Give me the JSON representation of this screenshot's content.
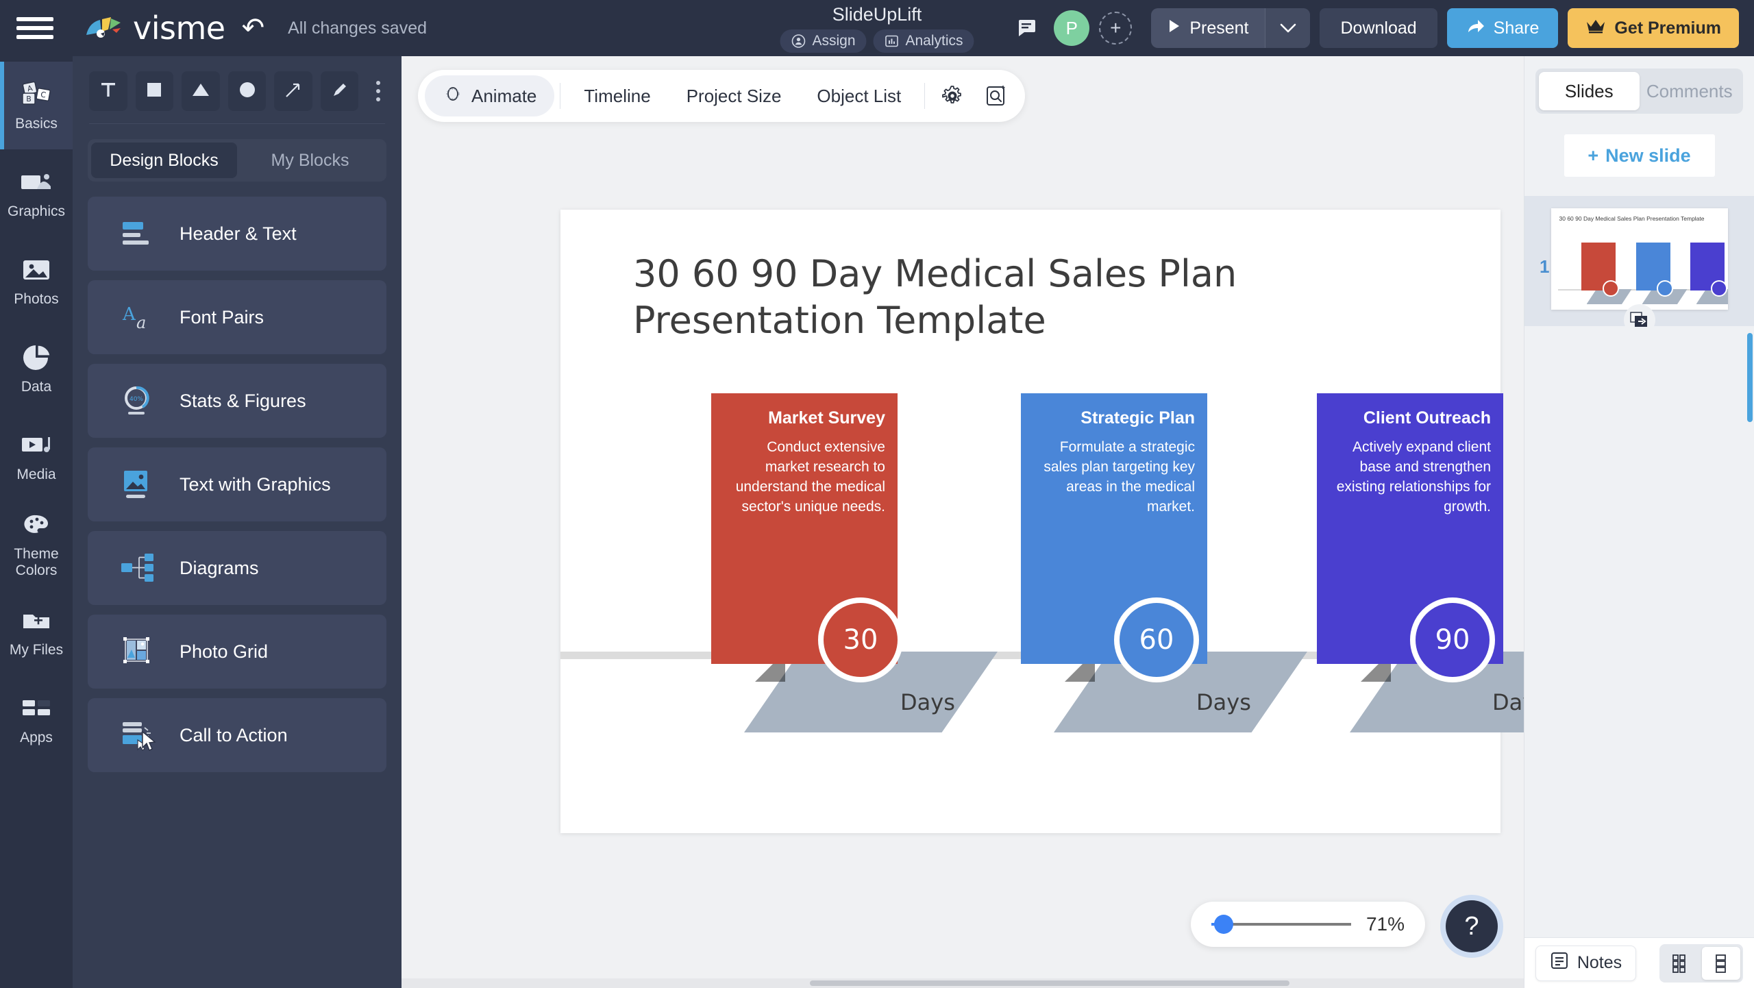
{
  "topbar": {
    "menu_icon": "hamburger-icon",
    "brand": "visme",
    "undo_icon": "undo-icon",
    "save_status": "All changes saved",
    "doc_title": "SlideUpLift",
    "assign_label": "Assign",
    "analytics_label": "Analytics",
    "comment_icon": "comment-icon",
    "avatar_initial": "P",
    "add_collaborator_icon": "add-user-icon",
    "present_label": "Present",
    "present_caret_icon": "chevron-down-icon",
    "download_label": "Download",
    "share_label": "Share",
    "premium_label": "Get Premium",
    "colors": {
      "share": "#4aa3dd",
      "premium": "#f5c25c",
      "bar": "#2b3245"
    }
  },
  "rail": {
    "items": [
      {
        "label": "Basics",
        "icon": "basics-cards-icon",
        "active": true
      },
      {
        "label": "Graphics",
        "icon": "graphics-icon",
        "active": false
      },
      {
        "label": "Photos",
        "icon": "photos-icon",
        "active": false
      },
      {
        "label": "Data",
        "icon": "data-piechart-icon",
        "active": false
      },
      {
        "label": "Media",
        "icon": "media-video-icon",
        "active": false
      },
      {
        "label": "Theme Colors",
        "icon": "palette-icon",
        "active": false
      },
      {
        "label": "My Files",
        "icon": "folder-plus-icon",
        "active": false
      },
      {
        "label": "Apps",
        "icon": "apps-grid-icon",
        "active": false
      }
    ]
  },
  "panel": {
    "shape_tools": [
      {
        "name": "text-tool",
        "icon": "text-T-icon"
      },
      {
        "name": "rectangle-tool",
        "icon": "square-icon"
      },
      {
        "name": "triangle-tool",
        "icon": "triangle-icon"
      },
      {
        "name": "circle-tool",
        "icon": "circle-icon"
      },
      {
        "name": "line-tool",
        "icon": "arrow-line-icon"
      },
      {
        "name": "draw-tool",
        "icon": "pencil-icon"
      },
      {
        "name": "more-tools",
        "icon": "more-vertical-icon"
      }
    ],
    "tabs": [
      {
        "label": "Design Blocks",
        "active": true
      },
      {
        "label": "My Blocks",
        "active": false
      }
    ],
    "blocks": [
      {
        "label": "Header & Text",
        "icon": "header-text-icon"
      },
      {
        "label": "Font Pairs",
        "icon": "font-pairs-icon"
      },
      {
        "label": "Stats & Figures",
        "icon": "stats-donut-icon",
        "badge": "40%"
      },
      {
        "label": "Text with Graphics",
        "icon": "text-graphics-icon"
      },
      {
        "label": "Diagrams",
        "icon": "diagrams-icon"
      },
      {
        "label": "Photo Grid",
        "icon": "photo-grid-icon"
      },
      {
        "label": "Call to Action",
        "icon": "call-to-action-icon"
      }
    ]
  },
  "canvas_toolbar": {
    "tabs": [
      {
        "label": "Animate",
        "icon": "animate-icon",
        "active": true
      },
      {
        "label": "Timeline",
        "icon": null,
        "active": false
      },
      {
        "label": "Project Size",
        "icon": null,
        "active": false
      },
      {
        "label": "Object List",
        "icon": null,
        "active": false
      }
    ],
    "settings_icon": "gear-icon",
    "preview_icon": "preview-search-icon"
  },
  "slide": {
    "title": "30 60 90 Day Medical Sales Plan Presentation Template",
    "ground_color": "#dcdcdc",
    "ramp_color": "#a8b4c2",
    "columns": [
      {
        "title": "Market Survey",
        "description": "Conduct extensive market research to understand the medical sector's unique needs.",
        "color": "#c7493a",
        "badge": "30",
        "badge_label": "Days"
      },
      {
        "title": "Strategic Plan",
        "description": "Formulate a strategic sales plan targeting key areas in the medical market.",
        "color": "#4a86d8",
        "badge": "60",
        "badge_label": "Days"
      },
      {
        "title": "Client Outreach",
        "description": "Actively expand client base and strengthen existing relationships for growth.",
        "color": "#4a3fcf",
        "badge": "90",
        "badge_label": "Days"
      }
    ]
  },
  "zoom": {
    "value": "71%",
    "help_icon": "help-question-icon"
  },
  "right_panel": {
    "tabs": [
      {
        "label": "Slides",
        "active": true
      },
      {
        "label": "Comments",
        "active": false
      }
    ],
    "new_slide_label": "New slide",
    "new_slide_plus": "+",
    "slide_number": "1",
    "duplicate_icon": "duplicate-slide-icon",
    "notes_label": "Notes",
    "notes_icon": "notes-icon",
    "view_grid_icon": "grid-view-icon",
    "view_list_icon": "list-view-icon"
  }
}
